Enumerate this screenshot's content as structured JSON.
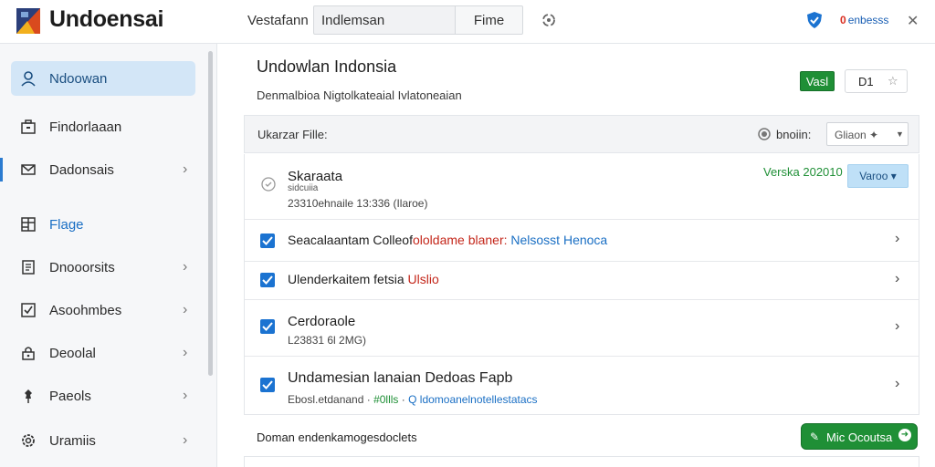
{
  "app": {
    "brand": "Undoensai",
    "search_label": "Vestafann",
    "search_value": "Indlemsan",
    "file_button": "Fime",
    "notifications": "enbesss",
    "notification_count": "0"
  },
  "sidebar": {
    "items": [
      {
        "label": "Ndoowan",
        "icon": "user-icon"
      },
      {
        "label": "Findorlaaan",
        "icon": "briefcase-icon"
      },
      {
        "label": "Dadonsais",
        "icon": "mail-icon"
      },
      {
        "label": "Flage",
        "icon": "grid-icon"
      },
      {
        "label": "Dnooorsits",
        "icon": "document-icon"
      },
      {
        "label": "Asoohmbes",
        "icon": "checkbox-icon"
      },
      {
        "label": "Deoolal",
        "icon": "lock-icon"
      },
      {
        "label": "Paeols",
        "icon": "pin-icon"
      },
      {
        "label": "Uramiis",
        "icon": "gear-icon"
      }
    ]
  },
  "main": {
    "title": "Undowlan Indonsia",
    "subtitle": "Denmalbioa Nigtolkateaial Ivlatoneaian",
    "badge": "Vasl",
    "segment_value": "D1",
    "file_header": {
      "title": "Ukarzar Fille:",
      "state": "bnoiin:",
      "select_value": "Gliaon"
    },
    "rows": [
      {
        "title": "Skaraata",
        "small": "sidcuiia",
        "meta": "23310ehnaile 13:336 (Ilaroe)",
        "version": "Verska 202010",
        "button": "Varoo"
      },
      {
        "parts": [
          "Seacalaantam Colleof",
          "ololdame blaner:",
          " Nelsosst Henoca"
        ]
      },
      {
        "parts": [
          "Ulenderkaitem fetsia ",
          "Ulslio"
        ]
      },
      {
        "title": "Cerdoraole",
        "meta": "L23831 6l 2MG)"
      },
      {
        "title": "Undamesian lanaian Dedoas Fapb",
        "meta_parts": [
          "Ebosl.etdanand · ",
          "#0llls",
          " · ",
          "Q ldomoanelnotellestatacs"
        ]
      }
    ],
    "footer_text": "Doman endenkamogesdoclets",
    "action_button": "Mic Ocoutsa"
  },
  "colors": {
    "accent_blue": "#1b73d1",
    "green": "#1f8f36",
    "red": "#c4271b",
    "sidebar_active": "#d3e6f7"
  }
}
